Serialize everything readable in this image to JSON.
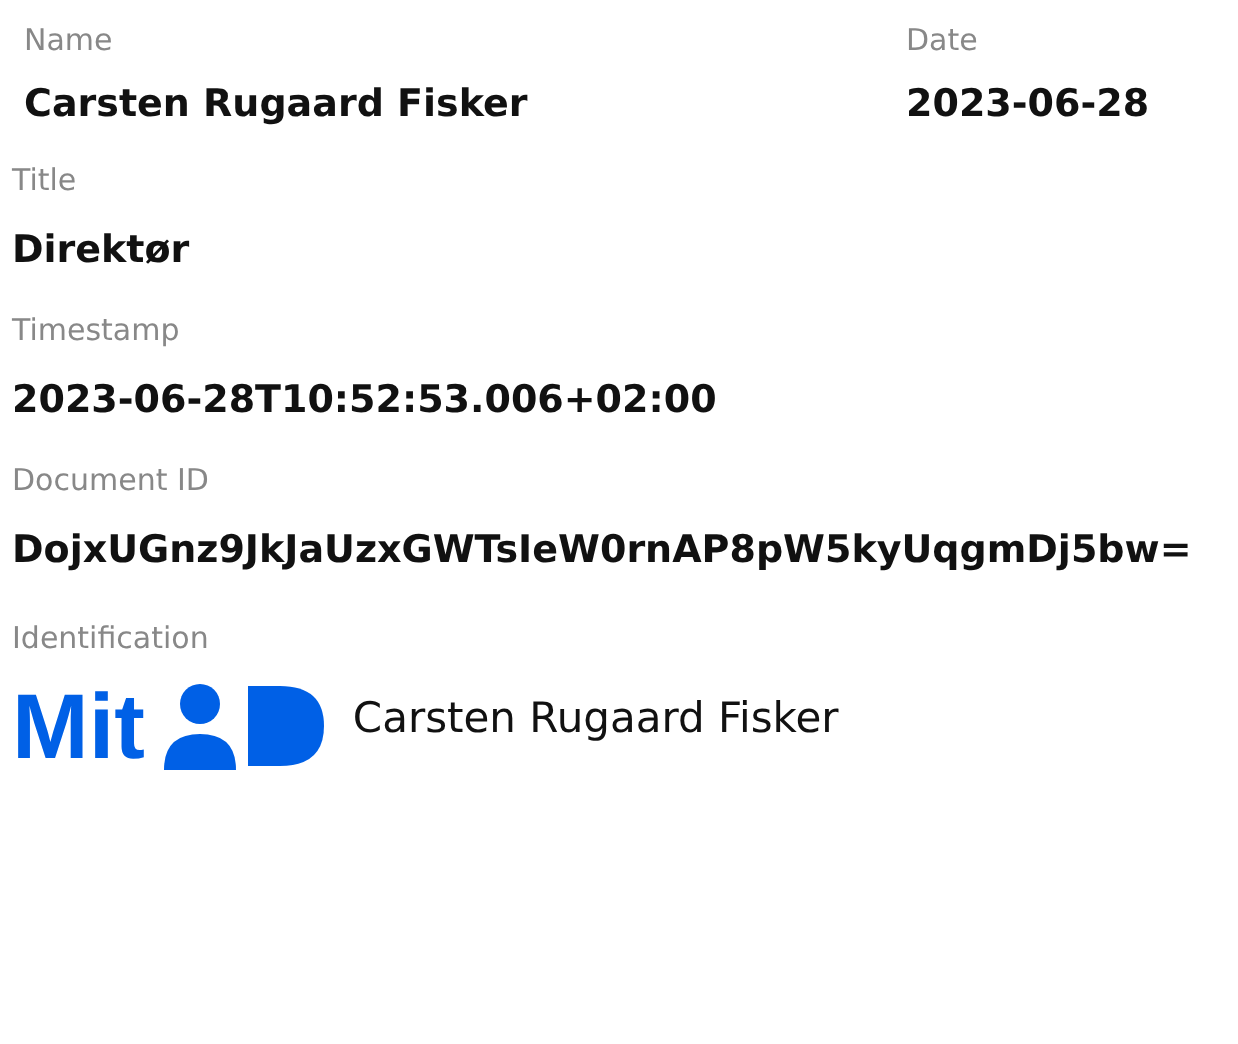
{
  "name": {
    "label": "Name",
    "value": "Carsten Rugaard Fisker"
  },
  "date": {
    "label": "Date",
    "value": "2023-06-28"
  },
  "fields": [
    {
      "label": "Title",
      "value": "Direktør"
    },
    {
      "label": "Timestamp",
      "value": "2023-06-28T10:52:53.006+02:00"
    },
    {
      "label": "Document ID",
      "value": "DojxUGnz9JkJaUzxGWTsIeW0rnAP8pW5kyUqgmDj5bw="
    }
  ],
  "identification": {
    "label": "Identification",
    "logo_text": "Mit",
    "value": "Carsten Rugaard Fisker"
  }
}
